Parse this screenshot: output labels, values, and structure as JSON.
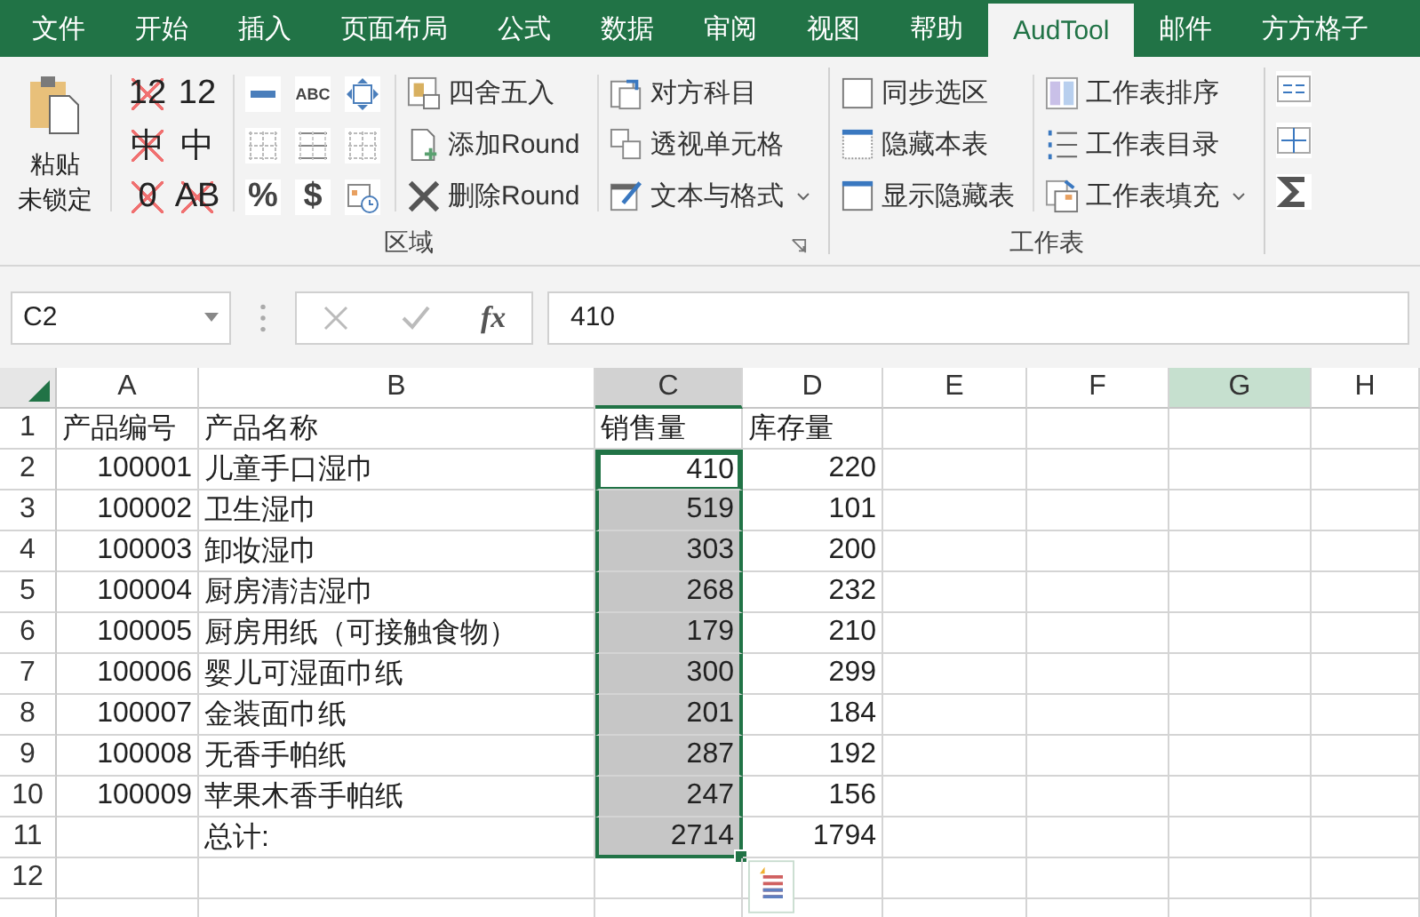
{
  "tabs": [
    {
      "label": "文件",
      "selected": false
    },
    {
      "label": "开始",
      "selected": false
    },
    {
      "label": "插入",
      "selected": false
    },
    {
      "label": "页面布局",
      "selected": false
    },
    {
      "label": "公式",
      "selected": false
    },
    {
      "label": "数据",
      "selected": false
    },
    {
      "label": "审阅",
      "selected": false
    },
    {
      "label": "视图",
      "selected": false
    },
    {
      "label": "帮助",
      "selected": false
    },
    {
      "label": "AudTool",
      "selected": true
    },
    {
      "label": "邮件",
      "selected": false
    },
    {
      "label": "方方格子",
      "selected": false
    }
  ],
  "ribbon": {
    "paste_button": {
      "lines": [
        "粘贴",
        "未锁定"
      ]
    },
    "format_toggles": [
      {
        "text": "12",
        "crossed": true
      },
      {
        "text": "12",
        "crossed": false
      },
      {
        "text": "中",
        "crossed": true
      },
      {
        "text": "中",
        "crossed": false
      },
      {
        "text": "0",
        "crossed": true
      },
      {
        "text": "AB",
        "crossed": true
      }
    ],
    "small_tools": [
      {
        "kind": "minus"
      },
      {
        "kind": "text",
        "text": "ABC"
      },
      {
        "kind": "move"
      },
      {
        "kind": "grid-dotted"
      },
      {
        "kind": "grid-lines"
      },
      {
        "kind": "grid-dotted"
      },
      {
        "kind": "text",
        "text": "%"
      },
      {
        "kind": "text",
        "text": "$"
      },
      {
        "kind": "date"
      }
    ],
    "region_buttons": [
      {
        "label": "四舍五入",
        "kind": "round"
      },
      {
        "label": "添加Round",
        "kind": "add"
      },
      {
        "label": "删除Round",
        "kind": "delete"
      }
    ],
    "region_buttons_2": [
      {
        "label": "对方科目",
        "kind": "account",
        "dropdown": false
      },
      {
        "label": "透视单元格",
        "kind": "pivot",
        "dropdown": false
      },
      {
        "label": "文本与格式",
        "kind": "edit",
        "dropdown": true
      }
    ],
    "region_label": "区域",
    "sheet_buttons": [
      {
        "label": "同步选区",
        "kind": "checkbox"
      },
      {
        "label": "隐藏本表",
        "kind": "hide"
      },
      {
        "label": "显示隐藏表",
        "kind": "show"
      }
    ],
    "sheet_buttons_2": [
      {
        "label": "工作表排序",
        "kind": "sort",
        "dropdown": false
      },
      {
        "label": "工作表目录",
        "kind": "list",
        "dropdown": false
      },
      {
        "label": "工作表填充",
        "kind": "fill",
        "dropdown": true
      }
    ],
    "sheet_label": "工作表",
    "extra_tools": [
      {
        "kind": "align"
      },
      {
        "kind": "split"
      },
      {
        "kind": "sum"
      }
    ]
  },
  "formula_bar": {
    "name_box": "C2",
    "fx": "fx",
    "formula": "410"
  },
  "sheet": {
    "columns": [
      {
        "label": "A",
        "selected": false,
        "hover": false
      },
      {
        "label": "B",
        "selected": false,
        "hover": false
      },
      {
        "label": "C",
        "selected": true,
        "hover": false
      },
      {
        "label": "D",
        "selected": false,
        "hover": false
      },
      {
        "label": "E",
        "selected": false,
        "hover": false
      },
      {
        "label": "F",
        "selected": false,
        "hover": false
      },
      {
        "label": "G",
        "selected": false,
        "hover": true
      },
      {
        "label": "H",
        "selected": false,
        "hover": false
      }
    ],
    "rows": [
      {
        "number": "1",
        "cells": [
          "产品编号",
          "产品名称",
          "销售量",
          "库存量"
        ],
        "selected": false,
        "active": false
      },
      {
        "number": "2",
        "cells": [
          "100001",
          "儿童手口湿巾",
          "410",
          "220"
        ],
        "selected": true,
        "active": true
      },
      {
        "number": "3",
        "cells": [
          "100002",
          "卫生湿巾",
          "519",
          "101"
        ],
        "selected": true,
        "active": false
      },
      {
        "number": "4",
        "cells": [
          "100003",
          "卸妆湿巾",
          "303",
          "200"
        ],
        "selected": true,
        "active": false
      },
      {
        "number": "5",
        "cells": [
          "100004",
          "厨房清洁湿巾",
          "268",
          "232"
        ],
        "selected": true,
        "active": false
      },
      {
        "number": "6",
        "cells": [
          "100005",
          "厨房用纸（可接触食物）",
          "179",
          "210"
        ],
        "selected": true,
        "active": false
      },
      {
        "number": "7",
        "cells": [
          "100006",
          "婴儿可湿面巾纸",
          "300",
          "299"
        ],
        "selected": true,
        "active": false
      },
      {
        "number": "8",
        "cells": [
          "100007",
          "金装面巾纸",
          "201",
          "184"
        ],
        "selected": true,
        "active": false
      },
      {
        "number": "9",
        "cells": [
          "100008",
          "无香手帕纸",
          "287",
          "192"
        ],
        "selected": true,
        "active": false
      },
      {
        "number": "10",
        "cells": [
          "100009",
          "苹果木香手帕纸",
          "247",
          "156"
        ],
        "selected": true,
        "active": false
      },
      {
        "number": "11",
        "cells": [
          "",
          "总计:",
          "2714",
          "1794"
        ],
        "selected": true,
        "active": false
      },
      {
        "number": "12",
        "cells": [
          "",
          "",
          "",
          ""
        ],
        "selected": false,
        "active": false
      }
    ]
  }
}
